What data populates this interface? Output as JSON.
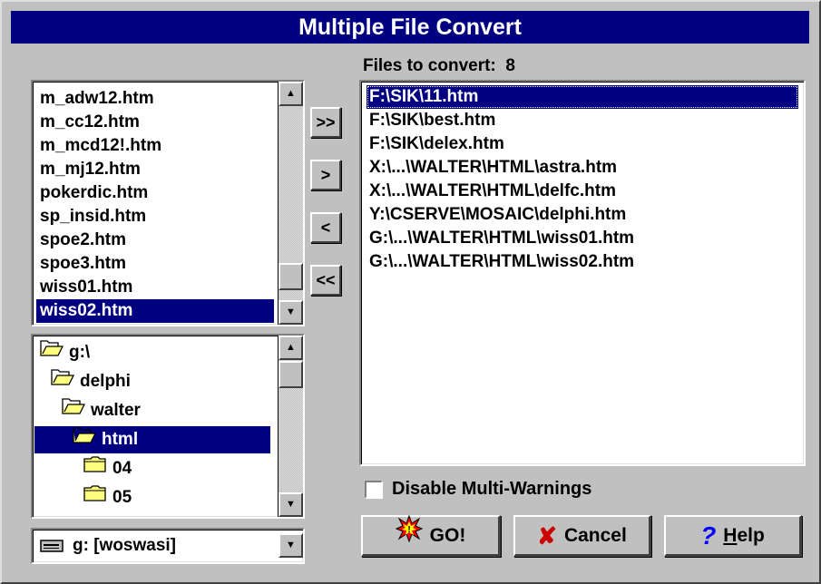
{
  "window": {
    "title": "Multiple File Convert"
  },
  "files_to_convert_label": "Files to convert:",
  "files_to_convert_count": "8",
  "source_files": [
    {
      "label": "m_adw12.htm",
      "selected": false
    },
    {
      "label": "m_cc12.htm",
      "selected": false
    },
    {
      "label": "m_mcd12!.htm",
      "selected": false
    },
    {
      "label": "m_mj12.htm",
      "selected": false
    },
    {
      "label": "pokerdic.htm",
      "selected": false
    },
    {
      "label": "sp_insid.htm",
      "selected": false
    },
    {
      "label": "spoe2.htm",
      "selected": false
    },
    {
      "label": "spoe3.htm",
      "selected": false
    },
    {
      "label": "wiss01.htm",
      "selected": false
    },
    {
      "label": "wiss02.htm",
      "selected": true
    }
  ],
  "directory_tree": [
    {
      "label": "g:\\",
      "icon": "folder-open-icon",
      "level": 0,
      "selected": false
    },
    {
      "label": "delphi",
      "icon": "folder-open-icon",
      "level": 1,
      "selected": false
    },
    {
      "label": "walter",
      "icon": "folder-open-icon",
      "level": 2,
      "selected": false
    },
    {
      "label": "html",
      "icon": "folder-open-icon",
      "level": 3,
      "selected": true
    },
    {
      "label": "04",
      "icon": "folder-closed-icon",
      "level": 4,
      "selected": false
    },
    {
      "label": "05",
      "icon": "folder-closed-icon",
      "level": 4,
      "selected": false
    }
  ],
  "drive": {
    "value": "g: [woswasi]",
    "icon": "drive-icon"
  },
  "move_buttons": {
    "add_all": ">>",
    "add": ">",
    "remove": "<",
    "remove_all": "<<"
  },
  "files_list": [
    {
      "label": "F:\\SIK\\11.htm",
      "selected": true
    },
    {
      "label": "F:\\SIK\\best.htm",
      "selected": false
    },
    {
      "label": "F:\\SIK\\delex.htm",
      "selected": false
    },
    {
      "label": "X:\\...\\WALTER\\HTML\\astra.htm",
      "selected": false
    },
    {
      "label": "X:\\...\\WALTER\\HTML\\delfc.htm",
      "selected": false
    },
    {
      "label": "Y:\\CSERVE\\MOSAIC\\delphi.htm",
      "selected": false
    },
    {
      "label": "G:\\...\\WALTER\\HTML\\wiss01.htm",
      "selected": false
    },
    {
      "label": "G:\\...\\WALTER\\HTML\\wiss02.htm",
      "selected": false
    }
  ],
  "disable_multi_warnings": {
    "label": "Disable Multi-Warnings",
    "checked": false
  },
  "buttons": {
    "go": "GO!",
    "cancel": "Cancel",
    "help_prefix": "",
    "help_underline": "H",
    "help_rest": "elp"
  },
  "colors": {
    "title_bar": "#000080",
    "face": "#c0c0c0",
    "selection": "#000080",
    "cancel_x": "#cc0000",
    "help_q": "#0000ff",
    "go_burst": "#ff0000"
  }
}
